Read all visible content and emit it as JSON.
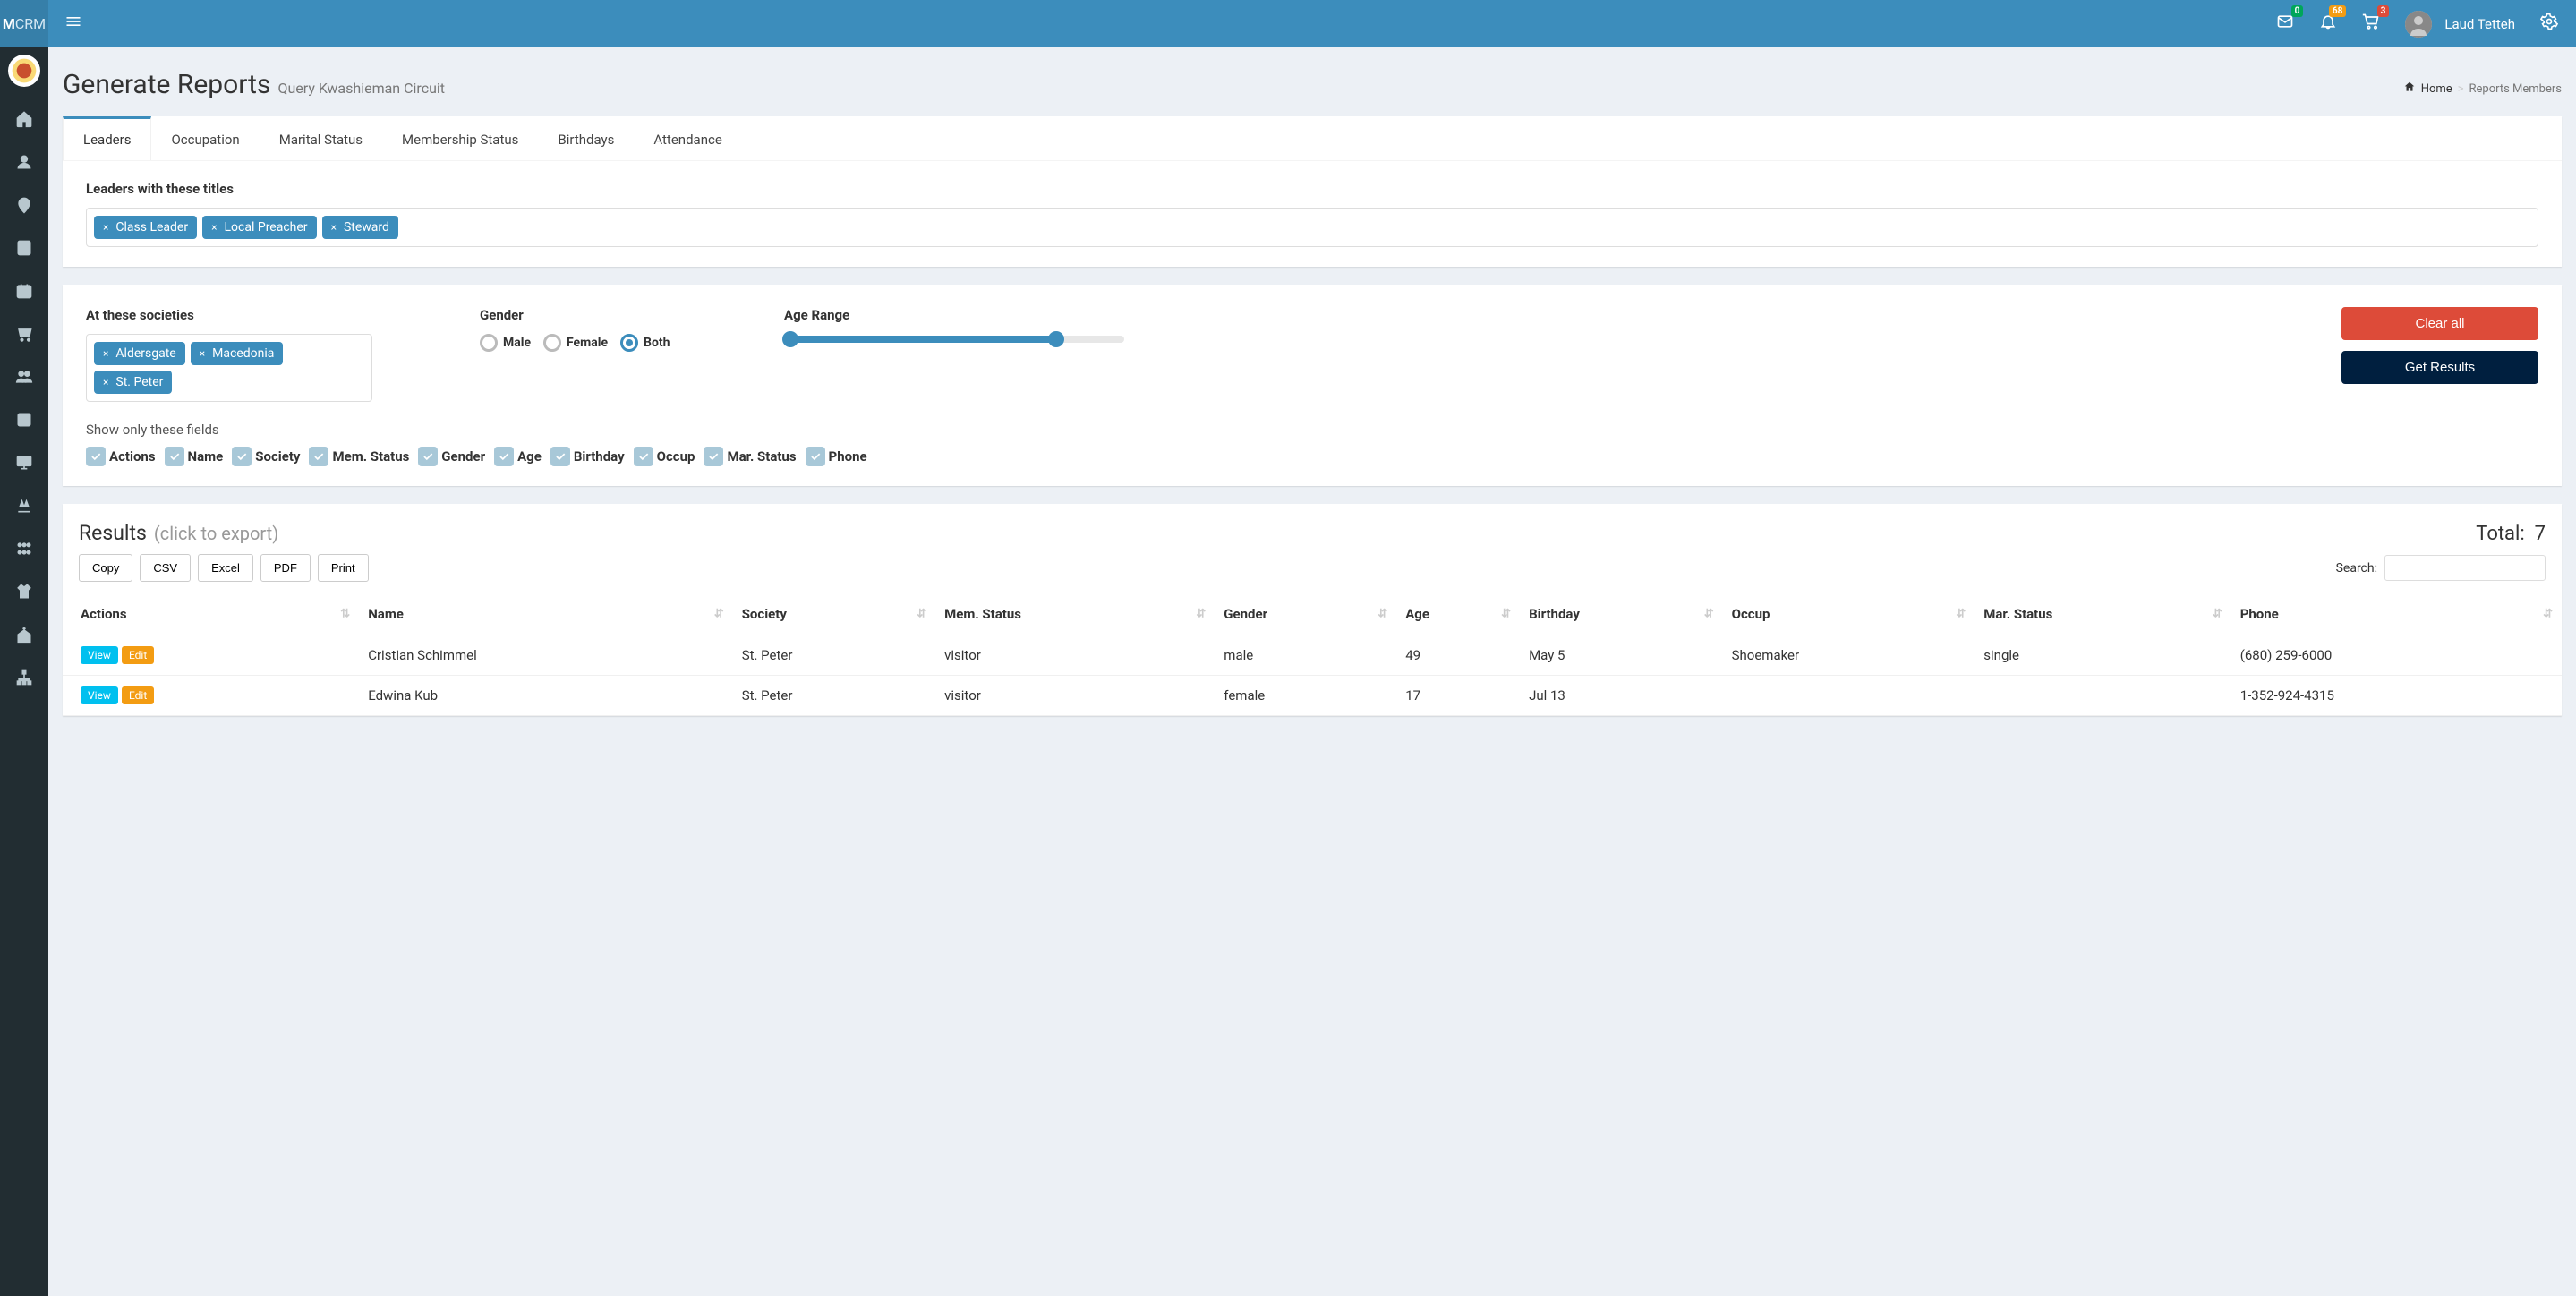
{
  "brand": {
    "prefix": "M",
    "suffix": "CRM"
  },
  "topbar": {
    "badges": {
      "mail": "0",
      "bell": "68",
      "cart": "3"
    },
    "username": "Laud Tetteh"
  },
  "page": {
    "title": "Generate Reports",
    "subtitle": "Query Kwashieman Circuit"
  },
  "breadcrumb": {
    "home": "Home",
    "current": "Reports Members"
  },
  "tabs": [
    "Leaders",
    "Occupation",
    "Marital Status",
    "Membership Status",
    "Birthdays",
    "Attendance"
  ],
  "active_tab": 0,
  "leaders_filter": {
    "label": "Leaders with these titles",
    "tags": [
      "Class Leader",
      "Local Preacher",
      "Steward"
    ]
  },
  "societies_filter": {
    "label": "At these societies",
    "tags": [
      "Aldersgate",
      "Macedonia",
      "St. Peter"
    ]
  },
  "gender_filter": {
    "label": "Gender",
    "options": [
      "Male",
      "Female",
      "Both"
    ],
    "selected": 2
  },
  "age_filter": {
    "label": "Age Range"
  },
  "buttons": {
    "clear": "Clear all",
    "get": "Get Results"
  },
  "fields_filter": {
    "label": "Show only these fields",
    "fields": [
      "Actions",
      "Name",
      "Society",
      "Mem. Status",
      "Gender",
      "Age",
      "Birthday",
      "Occup",
      "Mar. Status",
      "Phone"
    ]
  },
  "results": {
    "title": "Results",
    "hint": "(click to export)",
    "total_label": "Total:",
    "total": "7",
    "export_buttons": [
      "Copy",
      "CSV",
      "Excel",
      "PDF",
      "Print"
    ],
    "search_label": "Search:",
    "columns": [
      "Actions",
      "Name",
      "Society",
      "Mem. Status",
      "Gender",
      "Age",
      "Birthday",
      "Occup",
      "Mar. Status",
      "Phone"
    ],
    "row_buttons": {
      "view": "View",
      "edit": "Edit"
    },
    "rows": [
      {
        "name": "Cristian Schimmel",
        "society": "St. Peter",
        "mem_status": "visitor",
        "gender": "male",
        "age": "49",
        "birthday": "May 5",
        "occup": "Shoemaker",
        "mar_status": "single",
        "phone": "(680) 259-6000"
      },
      {
        "name": "Edwina Kub",
        "society": "St. Peter",
        "mem_status": "visitor",
        "gender": "female",
        "age": "17",
        "birthday": "Jul 13",
        "occup": "",
        "mar_status": "",
        "phone": "1-352-924-4315"
      }
    ]
  }
}
